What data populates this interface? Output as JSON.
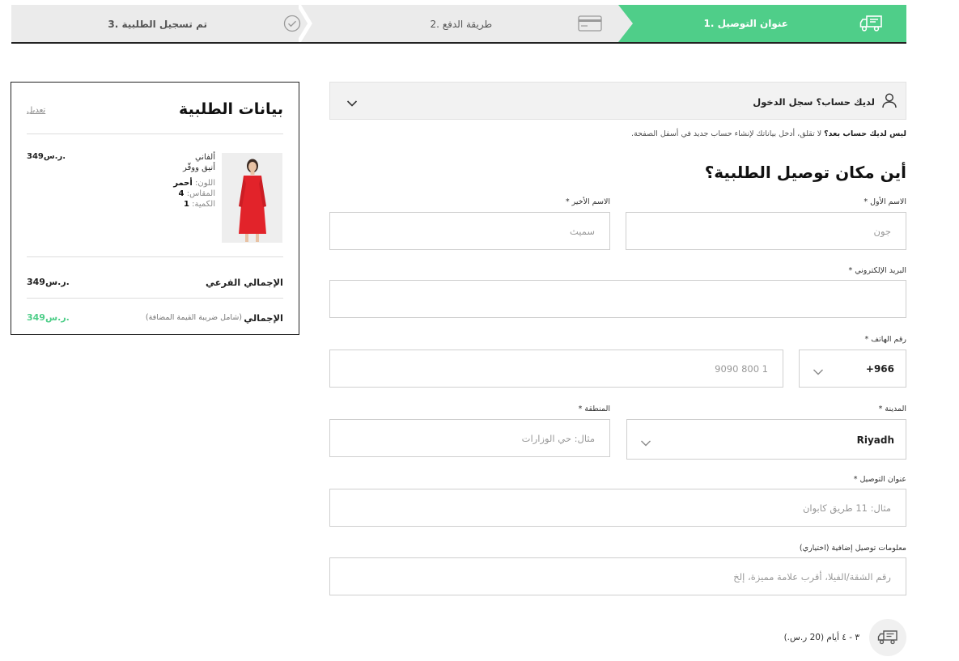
{
  "steps": {
    "delivery": "1. عنوان التوصيل",
    "payment": "2. طريقة الدفع",
    "done": "3. تم تسجيل الطلبية"
  },
  "summary": {
    "title": "بيانات الطلبية",
    "edit": "تعديل",
    "product": {
      "brand": "ألفاني",
      "name": "أنيق ووقّر",
      "color_label": "اللون:",
      "color_value": "أحمر",
      "size_label": "المقاس:",
      "size_value": "4",
      "qty_label": "الكمية:",
      "qty_value": "1",
      "price": "349ر.س."
    },
    "subtotal_label": "الإجمالي الفرعي",
    "subtotal_value": "349ر.س.",
    "total_label": "الإجمالي",
    "total_note": "(شامل ضريبة القيمة المضافة)",
    "total_value": "349ر.س."
  },
  "login": {
    "text": "لديك حساب؟ سجل الدخول"
  },
  "hint": {
    "bold": "ليس لديك حساب بعد؟",
    "rest": " لا تقلق، أدخل بياناتك لإنشاء حساب جديد في أسفل الصفحة."
  },
  "form": {
    "heading": "أين مكان توصيل الطلبية؟",
    "first_name_label": "الاسم الأول *",
    "first_name_placeholder": "جون",
    "last_name_label": "الاسم الأخير *",
    "last_name_placeholder": "سميث",
    "email_label": "البريد الإلكتروني *",
    "phone_label": "رقم الهاتف *",
    "phone_code": "+966",
    "phone_placeholder": "1 800 9090",
    "city_label": "المدينة *",
    "city_value": "Riyadh",
    "region_label": "المنطقة *",
    "region_placeholder": "مثال: حي الوزارات",
    "address_label": "عنوان التوصيل *",
    "address_placeholder": "مثال: 11 طريق كابوان",
    "extra_label": "معلومات توصيل إضافية (اختياري)",
    "extra_placeholder": "رقم الشقة/الفيلا، أقرب علامة مميزة، إلخ"
  },
  "delivery": {
    "text": "٣ - ٤ أيام (20 ر.س.)"
  },
  "colors": {
    "accent": "#4fce89",
    "dress": "#e2232a"
  }
}
